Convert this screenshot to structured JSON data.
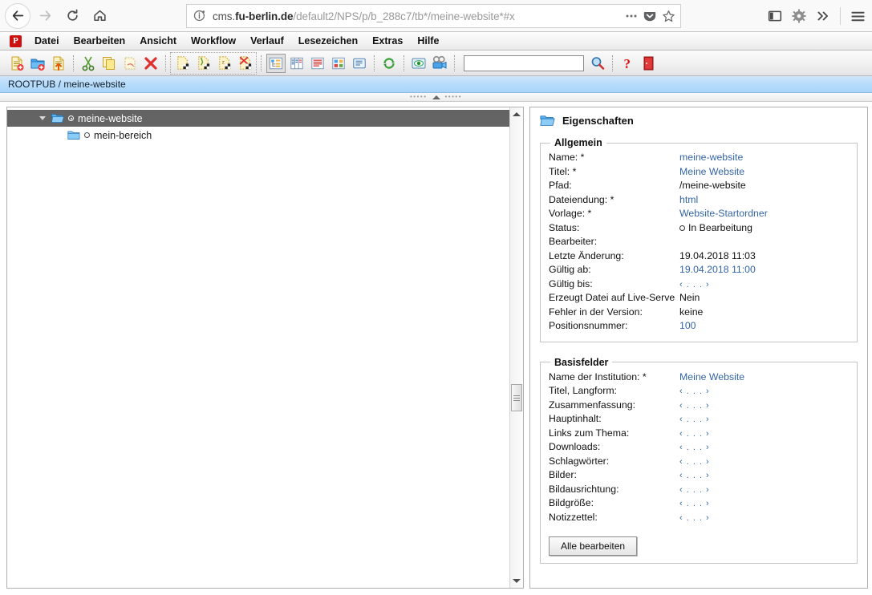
{
  "browser": {
    "nav": {
      "back_label": "Back",
      "forward_label": "Forward",
      "reload_label": "Reload",
      "home_label": "Home"
    },
    "url": {
      "prefix": "cms.",
      "domain": "fu-berlin.de",
      "path": "/default2/NPS/p/b_288c7/tb*/meine-website*#x",
      "info_icon": "info-icon",
      "menu_icon": "page-actions-icon",
      "pocket_icon": "pocket-icon",
      "bookmark_icon": "star-icon"
    },
    "toolbar_right": {
      "sidebar_icon": "sidebar-icon",
      "gear_icon": "gear-icon",
      "overflow_icon": "double-chevron-icon",
      "menu_icon": "hamburger-menu-icon"
    }
  },
  "cms": {
    "logo_text": "P",
    "menu": [
      {
        "label": "Datei"
      },
      {
        "label": "Bearbeiten"
      },
      {
        "label": "Ansicht"
      },
      {
        "label": "Workflow"
      },
      {
        "label": "Verlauf"
      },
      {
        "label": "Lesezeichen"
      },
      {
        "label": "Extras"
      },
      {
        "label": "Hilfe"
      }
    ],
    "toolbar": {
      "groups": [
        {
          "buttons": [
            {
              "name": "new-page-icon"
            },
            {
              "name": "new-folder-icon"
            },
            {
              "name": "upload-file-icon"
            }
          ]
        },
        {
          "buttons": [
            {
              "name": "cut-icon"
            },
            {
              "name": "copy-icon"
            },
            {
              "name": "paste-icon"
            },
            {
              "name": "delete-icon"
            }
          ]
        },
        {
          "boxed": true,
          "buttons": [
            {
              "name": "page-marker-1-icon"
            },
            {
              "name": "page-marker-2-icon"
            },
            {
              "name": "page-marker-3-icon"
            },
            {
              "name": "page-marker-delete-icon"
            }
          ]
        },
        {
          "buttons": [
            {
              "name": "tree-view-icon",
              "pressed": true
            },
            {
              "name": "table-view-icon"
            },
            {
              "name": "list-view-icon"
            },
            {
              "name": "tile-view-icon"
            },
            {
              "name": "details-view-icon"
            }
          ]
        },
        {
          "buttons": [
            {
              "name": "refresh-icon"
            }
          ]
        },
        {
          "buttons": [
            {
              "name": "preview-icon"
            },
            {
              "name": "publish-icon"
            }
          ]
        }
      ],
      "search_placeholder": "",
      "search_value": "",
      "search_icon": "search-icon",
      "help_icon": "help-icon",
      "logout_icon": "logout-icon"
    },
    "breadcrumb": "ROOTPUB / meine-website",
    "splitter": {
      "name": "pane-splitter"
    }
  },
  "tree": {
    "rows": [
      {
        "label": "meine-website",
        "selected": true,
        "expanded": true,
        "depth": 0
      },
      {
        "label": "mein-bereich",
        "selected": false,
        "expanded": false,
        "depth": 1
      }
    ]
  },
  "properties": {
    "title": "Eigenschaften",
    "folder_icon": "folder-open-icon",
    "sections": [
      {
        "legend": "Allgemein",
        "rows": [
          {
            "label": "Name: *",
            "value": "meine-website",
            "style": "link"
          },
          {
            "label": "Titel: *",
            "value": "Meine Website",
            "style": "link"
          },
          {
            "label": "Pfad:",
            "value": "/meine-website",
            "style": "plain"
          },
          {
            "label": "Dateiendung: *",
            "value": "html",
            "style": "link"
          },
          {
            "label": "Vorlage: *",
            "value": "Website-Startordner",
            "style": "link"
          },
          {
            "label": "Status:",
            "value": "In Bearbeitung",
            "style": "status"
          },
          {
            "label": "Bearbeiter:",
            "value": "",
            "style": "plain"
          },
          {
            "label": "Letzte Änderung:",
            "value": "19.04.2018 11:03",
            "style": "plain"
          },
          {
            "label": "Gültig ab:",
            "value": "19.04.2018 11:00",
            "style": "link"
          },
          {
            "label": "Gültig bis:",
            "value": "‹ . . . ›",
            "style": "ellip"
          },
          {
            "label": "Erzeugt Datei auf Live-Serve",
            "value": "Nein",
            "style": "plain"
          },
          {
            "label": "Fehler in der Version:",
            "value": "keine",
            "style": "plain"
          },
          {
            "label": "Positionsnummer:",
            "value": "100",
            "style": "link"
          }
        ]
      },
      {
        "legend": "Basisfelder",
        "rows": [
          {
            "label": "Name der Institution: *",
            "value": "Meine Website",
            "style": "link"
          },
          {
            "label": "Titel, Langform:",
            "value": "‹ . . . ›",
            "style": "ellip"
          },
          {
            "label": "Zusammenfassung:",
            "value": "‹ . . . ›",
            "style": "ellip"
          },
          {
            "label": "Hauptinhalt:",
            "value": "‹ . . . ›",
            "style": "ellip"
          },
          {
            "label": "Links zum Thema:",
            "value": "‹ . . . ›",
            "style": "ellip"
          },
          {
            "label": "Downloads:",
            "value": "‹ . . . ›",
            "style": "ellip"
          },
          {
            "label": "Schlagwörter:",
            "value": "‹ . . . ›",
            "style": "ellip"
          },
          {
            "label": "Bilder:",
            "value": "‹ . . . ›",
            "style": "ellip"
          },
          {
            "label": "Bildausrichtung:",
            "value": "‹ . . . ›",
            "style": "ellip"
          },
          {
            "label": "Bildgröße:",
            "value": "‹ . . . ›",
            "style": "ellip"
          },
          {
            "label": "Notizzettel:",
            "value": "‹ . . . ›",
            "style": "ellip"
          }
        ],
        "button": "Alle bearbeiten"
      }
    ]
  },
  "colors": {
    "accent_link": "#3465a4",
    "selection": "#646464",
    "breadcrumb": "#b7dcfb",
    "logo_red": "#cc1111"
  }
}
